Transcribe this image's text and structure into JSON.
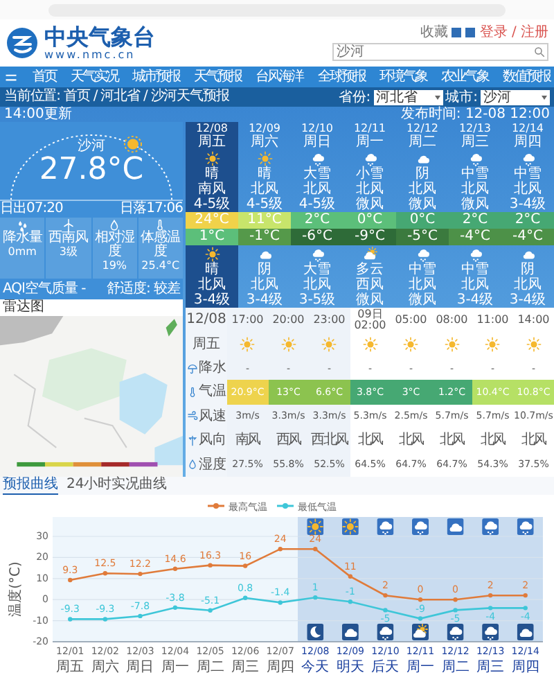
{
  "header": {
    "site_title": "中央气象台",
    "site_url": "www.nmc.cn",
    "top_links": [
      "收藏",
      "登录 / 注册"
    ],
    "search": {
      "placeholder": "沙河"
    }
  },
  "nav": [
    "首页",
    "天气实况",
    "城市预报",
    "天气预报",
    "台风海洋",
    "全球预报",
    "环境气象",
    "农业气象",
    "数值预报"
  ],
  "breadcrumb": "当前位置: 首页 / 河北省 / 沙河天气预报",
  "selectors": [
    {
      "label": "省份:",
      "value": "河北省"
    },
    {
      "label": "城市:",
      "value": "沙河"
    }
  ],
  "update": {
    "left": "14:00更新",
    "right": "发布时间: 12-08 12:00"
  },
  "current": {
    "city": "沙河",
    "temperature": "27.8°C",
    "sunrise": "日出07:20",
    "sunset": "日落17:06",
    "stats": [
      {
        "kind": "rain",
        "label": "降水量",
        "value": "0mm"
      },
      {
        "kind": "wind",
        "label": "西南风",
        "value": "3级"
      },
      {
        "kind": "humidity",
        "label": "相对湿度",
        "value": "19%"
      },
      {
        "kind": "thermo",
        "label": "体感温度",
        "value": "25.4°C"
      }
    ],
    "aqi": "AQI空气质量 -",
    "comfort": "舒适度: 较差"
  },
  "radar": {
    "title": "雷达图",
    "kind": "picture"
  },
  "forecast": [
    {
      "date": "12/08",
      "weekday": "周五",
      "selected": true,
      "day": {
        "kind": "sun",
        "weather": "晴",
        "wind": "南风",
        "level": "4-5级"
      },
      "high": {
        "text": "24°C",
        "color": "#f0d24a"
      },
      "low": {
        "text": "1°C",
        "color": "#5cbf7a"
      },
      "night": {
        "kind": "sun",
        "weather": "晴",
        "wind": "北风",
        "level": "3-4级"
      }
    },
    {
      "date": "12/09",
      "weekday": "周六",
      "selected": false,
      "day": {
        "kind": "sun",
        "weather": "晴",
        "wind": "北风",
        "level": "4-5级"
      },
      "high": {
        "text": "11°C",
        "color": "#c8e56b"
      },
      "low": {
        "text": "-1°C",
        "color": "#55994a"
      },
      "night": {
        "kind": "cloud",
        "weather": "阴",
        "wind": "北风",
        "level": "3-4级"
      }
    },
    {
      "date": "12/10",
      "weekday": "周日",
      "selected": false,
      "day": {
        "kind": "snow",
        "weather": "大雪",
        "wind": "北风",
        "level": "4-5级"
      },
      "high": {
        "text": "2°C",
        "color": "#5cbf7a"
      },
      "low": {
        "text": "-6°C",
        "color": "#2e6b38"
      },
      "night": {
        "kind": "snow",
        "weather": "大雪",
        "wind": "北风",
        "level": "3-5级"
      }
    },
    {
      "date": "12/11",
      "weekday": "周一",
      "selected": false,
      "day": {
        "kind": "snow",
        "weather": "小雪",
        "wind": "北风",
        "level": "微风"
      },
      "high": {
        "text": "0°C",
        "color": "#5cbf7a"
      },
      "low": {
        "text": "-9°C",
        "color": "#2e6b38"
      },
      "night": {
        "kind": "partly",
        "weather": "多云",
        "wind": "西风",
        "level": "微风"
      }
    },
    {
      "date": "12/12",
      "weekday": "周二",
      "selected": false,
      "day": {
        "kind": "cloud",
        "weather": "阴",
        "wind": "北风",
        "level": "微风"
      },
      "high": {
        "text": "0°C",
        "color": "#46a873"
      },
      "low": {
        "text": "-5°C",
        "color": "#3b7a3e"
      },
      "night": {
        "kind": "snow",
        "weather": "中雪",
        "wind": "北风",
        "level": "微风"
      }
    },
    {
      "date": "12/13",
      "weekday": "周三",
      "selected": false,
      "day": {
        "kind": "snow",
        "weather": "中雪",
        "wind": "北风",
        "level": "微风"
      },
      "high": {
        "text": "2°C",
        "color": "#46a873"
      },
      "low": {
        "text": "-4°C",
        "color": "#4d9148"
      },
      "night": {
        "kind": "snow",
        "weather": "中雪",
        "wind": "北风",
        "level": "3-4级"
      }
    },
    {
      "date": "12/14",
      "weekday": "周四",
      "selected": false,
      "day": {
        "kind": "snow",
        "weather": "中雪",
        "wind": "北风",
        "level": "3-4级"
      },
      "high": {
        "text": "2°C",
        "color": "#46a873"
      },
      "low": {
        "text": "-4°C",
        "color": "#4d9148"
      },
      "night": {
        "kind": "cloud",
        "weather": "阴",
        "wind": "北风",
        "level": "3-4级"
      }
    }
  ],
  "hourly": {
    "date": "12/08",
    "weekday": "周五",
    "hours": [
      {
        "time": "17:00",
        "kind": "sun",
        "shaded": true
      },
      {
        "time": "20:00",
        "kind": "sun",
        "shaded": true
      },
      {
        "time": "23:00",
        "kind": "sun",
        "shaded": true
      },
      {
        "time": "09日02:00",
        "kind": "sun",
        "shaded": false
      },
      {
        "time": "05:00",
        "kind": "sun",
        "shaded": false
      },
      {
        "time": "08:00",
        "kind": "sun",
        "shaded": false
      },
      {
        "time": "11:00",
        "kind": "sun",
        "shaded": false
      },
      {
        "time": "14:00",
        "kind": "sun",
        "shaded": false
      }
    ],
    "rows": [
      {
        "kind": "precip",
        "label": "降水",
        "cells": [
          {
            "text": "-"
          },
          {
            "text": "-"
          },
          {
            "text": "-"
          },
          {
            "text": "-"
          },
          {
            "text": "-"
          },
          {
            "text": "-"
          },
          {
            "text": "-"
          },
          {
            "text": "-"
          }
        ]
      },
      {
        "kind": "thermo",
        "label": "气温",
        "cells": [
          {
            "text": "20.9°C",
            "color": "#eed34d"
          },
          {
            "text": "13°C",
            "color": "#8cc34f"
          },
          {
            "text": "6.6°C",
            "color": "#8cc34f"
          },
          {
            "text": "3.8°C",
            "color": "#46a873"
          },
          {
            "text": "3°C",
            "color": "#46a873"
          },
          {
            "text": "1.2°C",
            "color": "#46a873"
          },
          {
            "text": "10.4°C",
            "color": "#b6e065"
          },
          {
            "text": "10.8°C",
            "color": "#b6e065"
          }
        ]
      },
      {
        "kind": "speed",
        "label": "风速",
        "cells": [
          {
            "text": "3m/s"
          },
          {
            "text": "3.3m/s"
          },
          {
            "text": "3.3m/s"
          },
          {
            "text": "5.3m/s"
          },
          {
            "text": "2.5m/s"
          },
          {
            "text": "5.7m/s"
          },
          {
            "text": "5.7m/s"
          },
          {
            "text": "10.7m/s"
          }
        ]
      },
      {
        "kind": "direction",
        "label": "风向",
        "cells": [
          {
            "text": "南风"
          },
          {
            "text": "西风"
          },
          {
            "text": "西北风"
          },
          {
            "text": "北风"
          },
          {
            "text": "北风"
          },
          {
            "text": "北风"
          },
          {
            "text": "北风"
          },
          {
            "text": "北风"
          }
        ]
      },
      {
        "kind": "humidity",
        "label": "湿度",
        "cells": [
          {
            "text": "27.5%"
          },
          {
            "text": "55.8%"
          },
          {
            "text": "52.5%"
          },
          {
            "text": "64.5%"
          },
          {
            "text": "64.7%"
          },
          {
            "text": "64.7%"
          },
          {
            "text": "54.3%"
          },
          {
            "text": "37.5%"
          }
        ]
      }
    ]
  },
  "chart": {
    "tabs": [
      {
        "label": "预报曲线",
        "selected": true
      },
      {
        "label": "24小时实况曲线",
        "selected": false
      }
    ],
    "weekdays": [
      "周五",
      "周六",
      "周日",
      "周一",
      "周二",
      "周三",
      "周四",
      "今天",
      "明天",
      "后天",
      "周一",
      "周二",
      "周三",
      "周四"
    ],
    "chart_data": {
      "type": "line",
      "ylabel": "温度(°C)",
      "categories": [
        "12/01",
        "12/02",
        "12/03",
        "12/04",
        "12/05",
        "12/06",
        "12/07",
        "12/08",
        "12/09",
        "12/10",
        "12/11",
        "12/12",
        "12/13",
        "12/14"
      ],
      "grid": true,
      "legend": "top",
      "series": [
        {
          "name": "最高气温",
          "color": "#e07b3a",
          "marker": "circle",
          "values": [
            9.3,
            12.5,
            12.2,
            14.6,
            16.3,
            16,
            24,
            24,
            11,
            2,
            0,
            0,
            2,
            2
          ]
        },
        {
          "name": "最低气温",
          "color": "#3ec6d8",
          "marker": "circle",
          "values": [
            -9.3,
            -9.3,
            -7.8,
            -3.8,
            -5.1,
            0.8,
            -1.4,
            1,
            -1,
            -5,
            -9,
            -5,
            -4,
            -4
          ]
        }
      ],
      "ylim": [
        -20,
        30
      ],
      "yticks": [
        -20,
        -10,
        0,
        10,
        20,
        30
      ],
      "data_labels": true
    }
  }
}
